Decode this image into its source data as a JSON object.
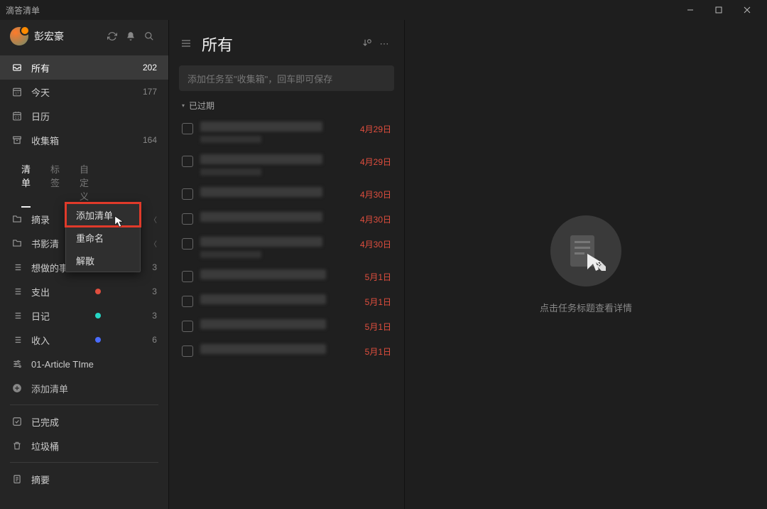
{
  "app_title": "滴答清单",
  "profile": {
    "username": "彭宏豪"
  },
  "window_controls": {
    "minimize": "–",
    "maximize": "▢",
    "close": "✕"
  },
  "sidebar": {
    "nav": [
      {
        "label": "所有",
        "count": "202",
        "active": true,
        "icon": "inbox"
      },
      {
        "label": "今天",
        "count": "177",
        "icon": "calendar-day"
      },
      {
        "label": "日历",
        "count": "",
        "icon": "calendar"
      },
      {
        "label": "收集箱",
        "count": "164",
        "icon": "archive"
      }
    ],
    "tabs": [
      {
        "label": "清单",
        "active": true
      },
      {
        "label": "标签",
        "active": false
      },
      {
        "label": "自定义",
        "active": false
      }
    ],
    "lists": [
      {
        "label": "摘录",
        "icon": "folder",
        "chevron": true
      },
      {
        "label": "书影清",
        "icon": "folder",
        "chevron": true
      },
      {
        "label": "想做的事",
        "icon": "list",
        "count": "3"
      },
      {
        "label": "支出",
        "icon": "list",
        "dot": "#e04e3e",
        "count": "3"
      },
      {
        "label": "日记",
        "icon": "list",
        "dot": "#26d7c5",
        "count": "3"
      },
      {
        "label": "收入",
        "icon": "list",
        "dot": "#4a6cff",
        "count": "6"
      },
      {
        "label": "01-Article TIme",
        "icon": "tune"
      }
    ],
    "add_list_label": "添加清单",
    "footer": [
      {
        "label": "已完成",
        "icon": "check"
      },
      {
        "label": "垃圾桶",
        "icon": "trash"
      },
      {
        "label": "摘要",
        "icon": "doc"
      }
    ]
  },
  "context_menu": {
    "items": [
      {
        "label": "添加清单",
        "highlighted": true
      },
      {
        "label": "重命名"
      },
      {
        "label": "解散"
      }
    ]
  },
  "main": {
    "title": "所有",
    "add_task_placeholder": "添加任务至\"收集箱\"，回车即可保存",
    "group_label": "已过期",
    "tasks": [
      {
        "date": "4月29日",
        "sub": true
      },
      {
        "date": "4月29日",
        "sub": true
      },
      {
        "date": "4月30日"
      },
      {
        "date": "4月30日"
      },
      {
        "date": "4月30日",
        "sub": true
      },
      {
        "date": "5月1日"
      },
      {
        "date": "5月1日"
      },
      {
        "date": "5月1日"
      },
      {
        "date": "5月1日"
      }
    ]
  },
  "detail": {
    "empty_text": "点击任务标题查看详情"
  }
}
